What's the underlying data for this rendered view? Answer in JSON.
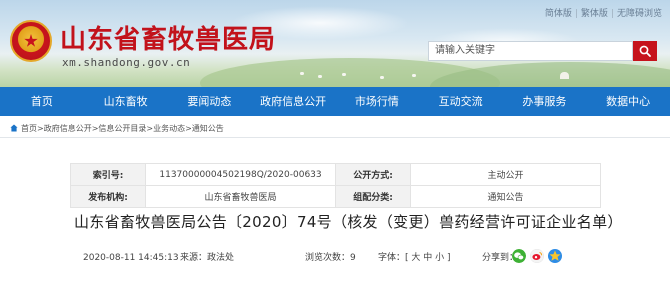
{
  "header": {
    "site_title": "山东省畜牧兽医局",
    "site_domain": "xm.shandong.gov.cn",
    "lang_links": [
      "简体版",
      "繁体版",
      "无障碍浏览"
    ],
    "search_placeholder": "请输入关键字",
    "brand_color": "#c2121b"
  },
  "nav": {
    "bg_color": "#1a73c7",
    "items": [
      "首页",
      "山东畜牧",
      "要闻动态",
      "政府信息公开",
      "市场行情",
      "互动交流",
      "办事服务",
      "数据中心"
    ]
  },
  "breadcrumb": "首页>政府信息公开>信息公开目录>业务动态>通知公告",
  "info_table": {
    "index_label": "索引号:",
    "index_value": "11370000004502198Q/2020-00633",
    "open_mode_label": "公开方式:",
    "open_mode_value": "主动公开",
    "publisher_label": "发布机构:",
    "publisher_value": "山东省畜牧兽医局",
    "category_label": "组配分类:",
    "category_value": "通知公告"
  },
  "article": {
    "title": "山东省畜牧兽医局公告〔2020〕74号（核发（变更）兽药经营许可证企业名单）",
    "datetime": "2020-08-11 14:45:13",
    "source": "来源：政法处",
    "views": "浏览次数：9",
    "font_size": "字体：[ 大 中 小 ]",
    "share_label": "分享到："
  }
}
